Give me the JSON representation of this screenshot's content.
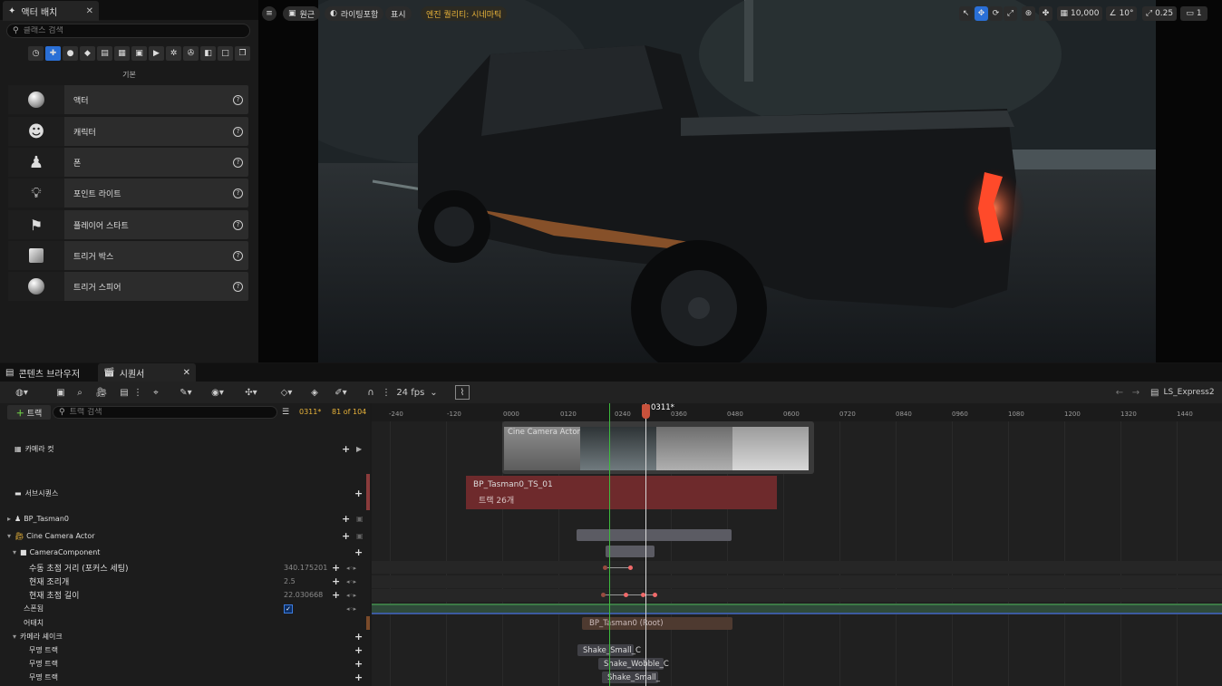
{
  "place_actors": {
    "tab_title": "액터 배치",
    "search_placeholder": "클래스 검색",
    "category_label": "기본",
    "items": [
      {
        "label": "액터"
      },
      {
        "label": "캐릭터"
      },
      {
        "label": "폰"
      },
      {
        "label": "포인트 라이트"
      },
      {
        "label": "플레이어 스타트"
      },
      {
        "label": "트리거 박스"
      },
      {
        "label": "트리거 스피어"
      }
    ]
  },
  "viewport": {
    "view_mode": "원근",
    "lighting": "라이팅포함",
    "show": "표시",
    "quality": "엔진 퀄리티: 시네마틱",
    "grid_value": "10,000",
    "angle_value": "10°",
    "scale_value": "0.25",
    "camera_speed": "1"
  },
  "bottom_tabs": {
    "content_browser": "콘텐츠 브라우저",
    "sequencer": "시퀀서"
  },
  "sequencer": {
    "fps": "24 fps",
    "sequence_name": "LS_Express2",
    "add_track": "트랙",
    "search_placeholder": "트랙 검색",
    "current_frame": "0311*",
    "track_count": "81 of 104",
    "playhead_label": "0311*",
    "ruler_ticks": [
      "-240",
      "-120",
      "0000",
      "0120",
      "0240",
      "0360",
      "0480",
      "0600",
      "0720",
      "0840",
      "0960",
      "1080",
      "1200",
      "1320",
      "1440"
    ],
    "tracks": {
      "camera_cuts": "카메라 컷",
      "subsequence": "서브시퀀스",
      "bp_tasman": "BP_Tasman0",
      "cine_camera": "Cine Camera Actor",
      "camera_component": "CameraComponent",
      "manual_focus": "수동 초점 거리 (포커스 세팅)",
      "manual_focus_value": "340.175201",
      "current_aperture": "현재 조리개",
      "current_aperture_value": "2.5",
      "current_focal": "현재 초점 길이",
      "current_focal_value": "22.030668",
      "spawned": "스폰됨",
      "attach": "어태치",
      "camera_shake": "카메라 셰이크",
      "unnamed_track": "무명 트랙"
    },
    "clips": {
      "cine_camera": "Cine Camera Actor",
      "subseq_name": "BP_Tasman0_TS_01",
      "subseq_tracks": "트랙 26개",
      "attach_clip": "BP_Tasman0 (Root)",
      "shake1": "Shake_Small_C",
      "shake2": "Shake_Wobble_C",
      "shake3": "Shake_Small_"
    }
  }
}
